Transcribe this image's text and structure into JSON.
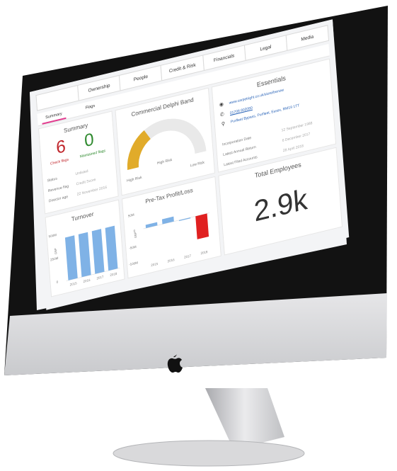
{
  "tabs": [
    "Ownership",
    "People",
    "Credit & Risk",
    "Financials",
    "Legal",
    "Media"
  ],
  "subtabs": {
    "active": "Summary",
    "flags": "Flags"
  },
  "summary": {
    "title": "Summary",
    "count_a": "6",
    "count_a_label": "Check flags",
    "count_b": "0",
    "count_b_label": "Maintained flags",
    "rows": [
      {
        "label": "Status",
        "value": "Unlisted"
      },
      {
        "label": "Revenue flag",
        "value": "Credit Score"
      },
      {
        "label": "Director age",
        "value": "22 November 2016"
      }
    ]
  },
  "delphi": {
    "title": "Commercial Delphi Band",
    "high": "High Risk",
    "mid": "High Risk",
    "low": "Low Risk",
    "level": 0.33,
    "accent": "#e1ab2a"
  },
  "essentials": {
    "title": "Essentials",
    "website": "www.carpetright.co.uk/store/benow",
    "phone": "01708 802080",
    "address": "Purfleet Bypass, Purfleet, Essex, RM19 1TT",
    "rows": [
      {
        "label": "Incorporation Date",
        "value": "12 September 1988"
      },
      {
        "label": "Latest Annual Return",
        "value": "6 December 2017"
      },
      {
        "label": "Latest Filed Accounts",
        "value": "28 April 2018"
      }
    ]
  },
  "turnover": {
    "title": "Turnover",
    "ylabel": "GBP",
    "ticks": [
      "500M",
      "250M",
      "0"
    ]
  },
  "pretax": {
    "title": "Pre-Tax Profit/Loss",
    "ylabel": "GBP",
    "ticks": [
      "50M",
      "0",
      "-50M",
      "-100M"
    ]
  },
  "employees": {
    "title": "Total Employees",
    "value": "2.9k"
  },
  "chart_data": [
    {
      "type": "bar",
      "title": "Turnover",
      "ylabel": "GBP",
      "categories": [
        "2015",
        "2016",
        "2017",
        "2018"
      ],
      "values": [
        460,
        460,
        460,
        460
      ],
      "ylim": [
        0,
        500
      ],
      "color": "#7fb2e6"
    },
    {
      "type": "bar",
      "title": "Pre-Tax Profit/Loss",
      "ylabel": "GBP",
      "categories": [
        "2015",
        "2016",
        "2017",
        "2018"
      ],
      "values": [
        10,
        15,
        0,
        -70
      ],
      "ylim": [
        -100,
        50
      ],
      "colors": [
        "#7fb2e6",
        "#7fb2e6",
        "#7fb2e6",
        "#e02020"
      ]
    }
  ],
  "colors": {
    "red": "#c0262c",
    "green": "#2f8a2f",
    "accent": "#e23a8e",
    "bar": "#7fb2e6"
  }
}
